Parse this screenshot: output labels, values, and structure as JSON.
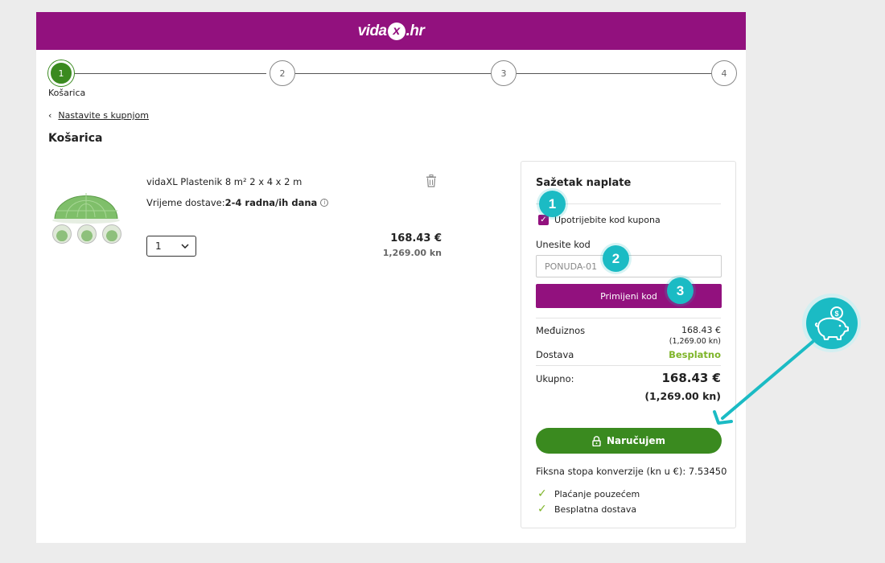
{
  "header": {
    "logo_left": "vida",
    "logo_x": "xl",
    "logo_right": ".hr"
  },
  "steps": [
    {
      "number": "1",
      "label": "Košarica",
      "active": true
    },
    {
      "number": "2"
    },
    {
      "number": "3"
    },
    {
      "number": "4"
    }
  ],
  "nav": {
    "back_icon": "‹",
    "back_link": "Nastavite s kupnjom"
  },
  "page_title": "Košarica",
  "product": {
    "name": "vidaXL Plastenik 8 m² 2 x 4 x 2 m",
    "delivery_label": "Vrijeme dostave:",
    "delivery_value": "2-4 radna/ih dana",
    "info_icon": "i",
    "quantity": "1",
    "price_eur": "168.43 €",
    "price_kn": "1,269.00 kn"
  },
  "summary": {
    "title": "Sažetak naplate",
    "coupon_checkbox_label": "Upotrijebite kod kupona",
    "coupon_checked": true,
    "code_label": "Unesite kod",
    "code_placeholder": "PONUDA-01",
    "apply_button": "Primijeni kod",
    "subtotal_label": "Međuiznos",
    "subtotal_eur": "168.43 €",
    "subtotal_kn": "(1,269.00 kn)",
    "shipping_label": "Dostava",
    "shipping_value": "Besplatno",
    "total_label": "Ukupno:",
    "total_eur": "168.43 €",
    "total_kn": "(1,269.00 kn)",
    "order_button": "Naručujem",
    "conversion_text": "Fiksna stopa konverzije (kn u €): 7.53450",
    "perks": [
      "Plaćanje pouzećem",
      "Besplatna dostava"
    ]
  },
  "annotations": {
    "badge_1": "1",
    "badge_2": "2",
    "badge_3": "3",
    "icon": "piggy-bank-icon"
  },
  "colors": {
    "brand": "#92117e",
    "accent_green": "#3a8a1f",
    "light_green": "#7fb52a",
    "teal": "#1bbbc4"
  }
}
